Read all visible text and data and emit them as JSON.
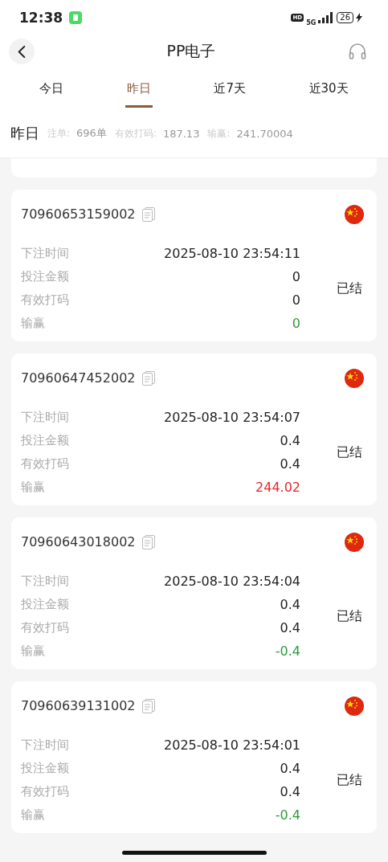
{
  "status_bar": {
    "time": "12:38",
    "hd": "HD",
    "network": "5G",
    "battery": "26"
  },
  "header": {
    "title": "PP电子"
  },
  "tabs": [
    {
      "label": "今日",
      "selected": false
    },
    {
      "label": "昨日",
      "selected": true
    },
    {
      "label": "近7天",
      "selected": false
    },
    {
      "label": "近30天",
      "selected": false
    }
  ],
  "summary": {
    "period": "昨日",
    "items": [
      {
        "label": "注单:",
        "value": "696单"
      },
      {
        "label": "有效打码:",
        "value": "187.13"
      },
      {
        "label": "输赢:",
        "value": "241.70004"
      }
    ]
  },
  "bets": [
    {
      "id": "70960653159002",
      "status": "已结",
      "rows": [
        {
          "label": "下注时间",
          "value": "2025-08-10 23:54:11"
        },
        {
          "label": "投注金额",
          "value": "0"
        },
        {
          "label": "有效打码",
          "value": "0"
        },
        {
          "label": "输赢",
          "value": "0",
          "color": "#2e9a3a"
        }
      ]
    },
    {
      "id": "70960647452002",
      "status": "已结",
      "rows": [
        {
          "label": "下注时间",
          "value": "2025-08-10 23:54:07"
        },
        {
          "label": "投注金额",
          "value": "0.4"
        },
        {
          "label": "有效打码",
          "value": "0.4"
        },
        {
          "label": "输赢",
          "value": "244.02",
          "color": "#e8242c"
        }
      ]
    },
    {
      "id": "70960643018002",
      "status": "已结",
      "rows": [
        {
          "label": "下注时间",
          "value": "2025-08-10 23:54:04"
        },
        {
          "label": "投注金额",
          "value": "0.4"
        },
        {
          "label": "有效打码",
          "value": "0.4"
        },
        {
          "label": "输赢",
          "value": "-0.4",
          "color": "#2e9a3a"
        }
      ]
    },
    {
      "id": "70960639131002",
      "status": "已结",
      "rows": [
        {
          "label": "下注时间",
          "value": "2025-08-10 23:54:01"
        },
        {
          "label": "投注金额",
          "value": "0.4"
        },
        {
          "label": "有效打码",
          "value": "0.4"
        },
        {
          "label": "输赢",
          "value": "-0.4",
          "color": "#2e9a3a"
        }
      ]
    }
  ]
}
